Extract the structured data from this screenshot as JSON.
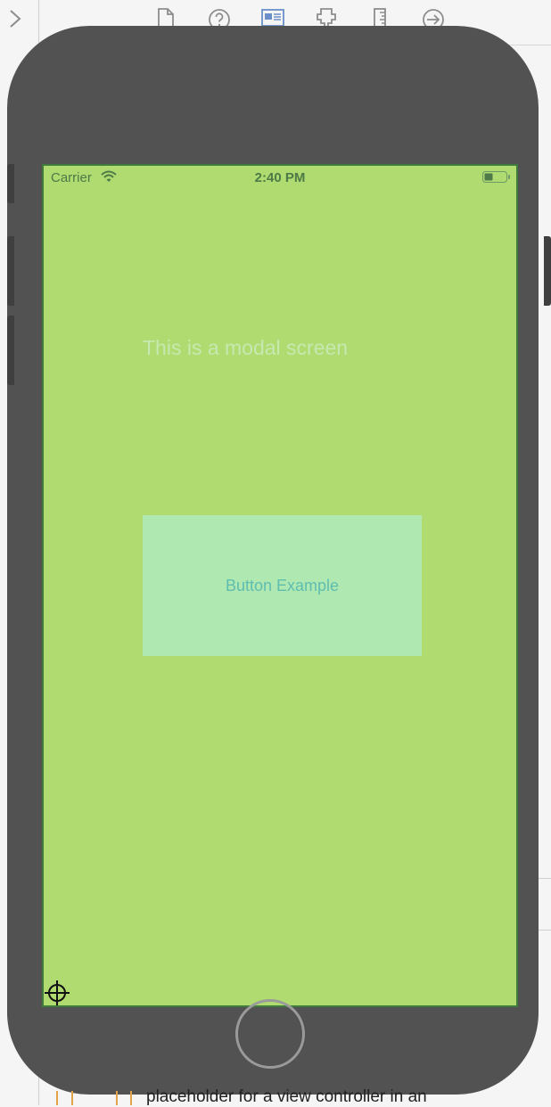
{
  "inspector_toolbar": {
    "icons": [
      "file-inspector-icon",
      "quick-help-icon",
      "identity-inspector-icon",
      "attributes-inspector-icon",
      "size-inspector-icon",
      "connections-inspector-icon"
    ]
  },
  "status_bar": {
    "carrier": "Carrier",
    "time": "2:40 PM"
  },
  "screen": {
    "background": "#afdb70",
    "label": "This is a modal screen",
    "button_label": "Button Example",
    "button_background": "#afe9b1"
  },
  "document_outline": {
    "partial_text": "placeholder for a view controller in an"
  }
}
